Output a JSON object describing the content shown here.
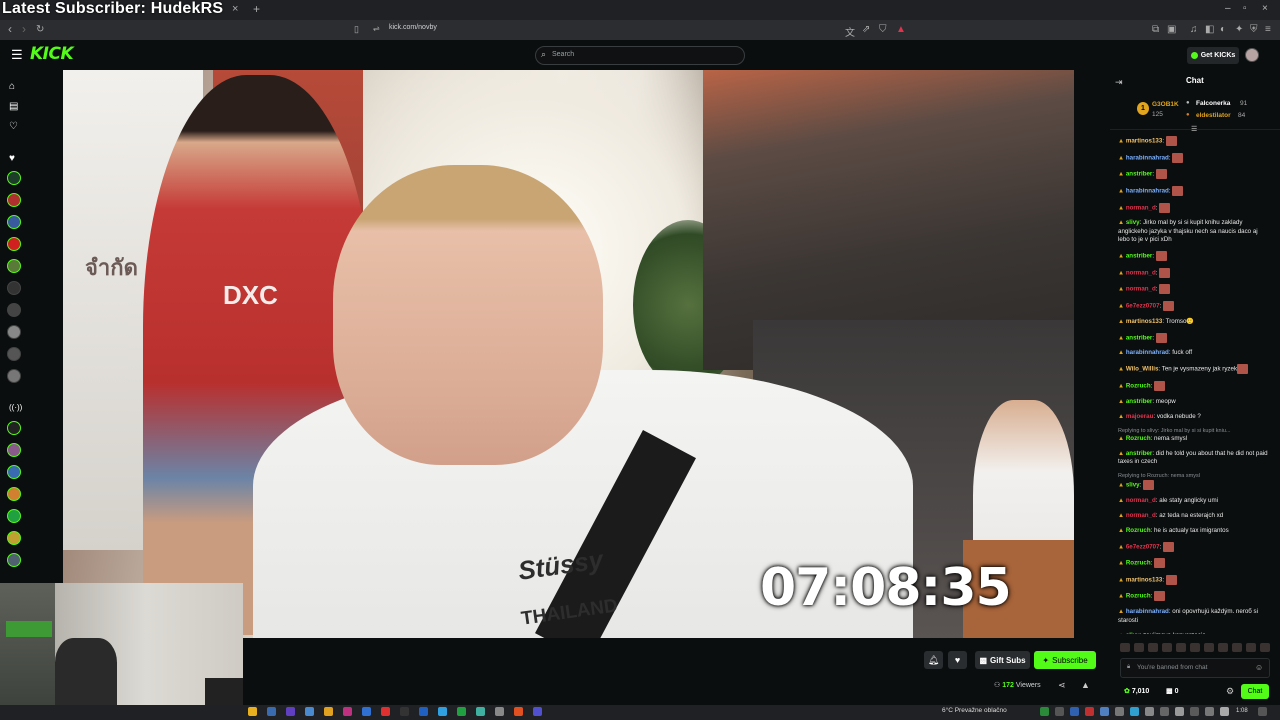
{
  "overlay": {
    "title": "Latest Subscriber: HudekRS"
  },
  "browser": {
    "url": "kick.com/novby",
    "tab_close": "×",
    "tab_new": "+",
    "win_min": "–",
    "win_max": "▫",
    "win_close": "×",
    "icons": [
      "back-icon",
      "forward-icon",
      "reload-icon",
      "bookmark-icon",
      "translate-icon",
      "share-icon",
      "shield-icon",
      "brave-rewards-icon",
      "extensions-icon",
      "wallet-icon",
      "sidebar-icon",
      "vpn-icon",
      "menu-icon"
    ]
  },
  "header": {
    "logo": "KICK",
    "search_placeholder": "Search",
    "get_kicks": "Get KICKs"
  },
  "stream": {
    "timer": "07:08:35",
    "shirt_brand": "Stüssy",
    "shirt_sub": "THAILAND",
    "jersey": "DXC",
    "truck_text": "จำกัด"
  },
  "actions": {
    "gift_subs": "Gift Subs",
    "subscribe": "Subscribe",
    "viewers_count": "172",
    "viewers_label": "Viewers"
  },
  "chat": {
    "title": "Chat",
    "leaderboard": {
      "top_name": "G3OB1K",
      "top_value": "125",
      "second_name": "Falconerka",
      "second_value": "91",
      "third_name": "eldestilator",
      "third_value": "84"
    },
    "messages": [
      {
        "user": "martinos133",
        "color": "#f0c26a",
        "text": "",
        "emote": true
      },
      {
        "user": "harabinnahrad",
        "color": "#7ab0ff",
        "text": "",
        "emote": true
      },
      {
        "user": "anstriber",
        "color": "#53fc18",
        "text": "",
        "emote": true
      },
      {
        "user": "harabinnahrad",
        "color": "#7ab0ff",
        "text": "",
        "emote": true
      },
      {
        "user": "norman_d",
        "color": "#e0334d",
        "text": "",
        "emote": true
      },
      {
        "user": "slivy",
        "color": "#53fc18",
        "text": "Jirko mal by si si kupit knihu zaklady anglickeho jazyka v thajsku nech sa naucis daco aj lebo to je v pici xDh",
        "emote": false
      },
      {
        "user": "anstriber",
        "color": "#53fc18",
        "text": "",
        "emote": true
      },
      {
        "user": "norman_d",
        "color": "#e0334d",
        "text": "",
        "emote": true
      },
      {
        "user": "norman_d",
        "color": "#e0334d",
        "text": "",
        "emote": true
      },
      {
        "user": "6e7ezz0707",
        "color": "#e0334d",
        "text": "",
        "emote": true
      },
      {
        "user": "martinos133",
        "color": "#f0c26a",
        "text": "Tromso🙂",
        "emote": false
      },
      {
        "user": "anstriber",
        "color": "#53fc18",
        "text": "",
        "emote": true
      },
      {
        "user": "harabinnahrad",
        "color": "#7ab0ff",
        "text": "fuck off",
        "emote": false
      },
      {
        "user": "Wilo_Willis",
        "color": "#f0c26a",
        "text": "Ten je vysmazeny jak ryzek",
        "emote": true
      },
      {
        "user": "Rozruch",
        "color": "#53fc18",
        "text": "",
        "emote": true
      },
      {
        "user": "anstriber",
        "color": "#53fc18",
        "text": "meopw",
        "emote": false
      },
      {
        "user": "majoerau",
        "color": "#e0334d",
        "text": "vodka nebude ?",
        "emote": false
      },
      {
        "user": "Rozruch",
        "color": "#53fc18",
        "text": "nema smysl",
        "emote": false,
        "reply": "Replying to slivy: Jirko mal by si si kupit kniu..."
      },
      {
        "user": "anstriber",
        "color": "#53fc18",
        "text": "did he told you about that he did not paid taxes in czech",
        "emote": false
      },
      {
        "user": "slivy",
        "color": "#53fc18",
        "text": "",
        "emote": true,
        "reply": "Replying to Rozruch: nema smysl"
      },
      {
        "user": "norman_d",
        "color": "#e0334d",
        "text": "ale staty anglicky umi",
        "emote": false
      },
      {
        "user": "norman_d",
        "color": "#e0334d",
        "text": "az teda na esterajch xd",
        "emote": false
      },
      {
        "user": "Rozruch",
        "color": "#53fc18",
        "text": "he is actualy tax imigrantos",
        "emote": false
      },
      {
        "user": "6e7ezz0707",
        "color": "#e0334d",
        "text": "",
        "emote": true
      },
      {
        "user": "Rozruch",
        "color": "#53fc18",
        "text": "",
        "emote": true
      },
      {
        "user": "martinos133",
        "color": "#f0c26a",
        "text": "",
        "emote": true
      },
      {
        "user": "Rozruch",
        "color": "#53fc18",
        "text": "",
        "emote": true
      },
      {
        "user": "harabinnahrad",
        "color": "#7ab0ff",
        "text": "oni opovrhujú každým. neroб si starosti",
        "emote": false
      },
      {
        "user": "slivy",
        "color": "#53fc18",
        "text": "zaujimava konverzacia",
        "emote": false
      }
    ],
    "input_placeholder": "You're banned from chat",
    "points": "7,010",
    "gift_count": "0",
    "chat_button": "Chat"
  },
  "taskbar": {
    "weather": "6°C  Prevažne oblačno",
    "time": "1:08"
  },
  "colors": {
    "accent": "#53fc18",
    "background": "#0b0e0f"
  }
}
